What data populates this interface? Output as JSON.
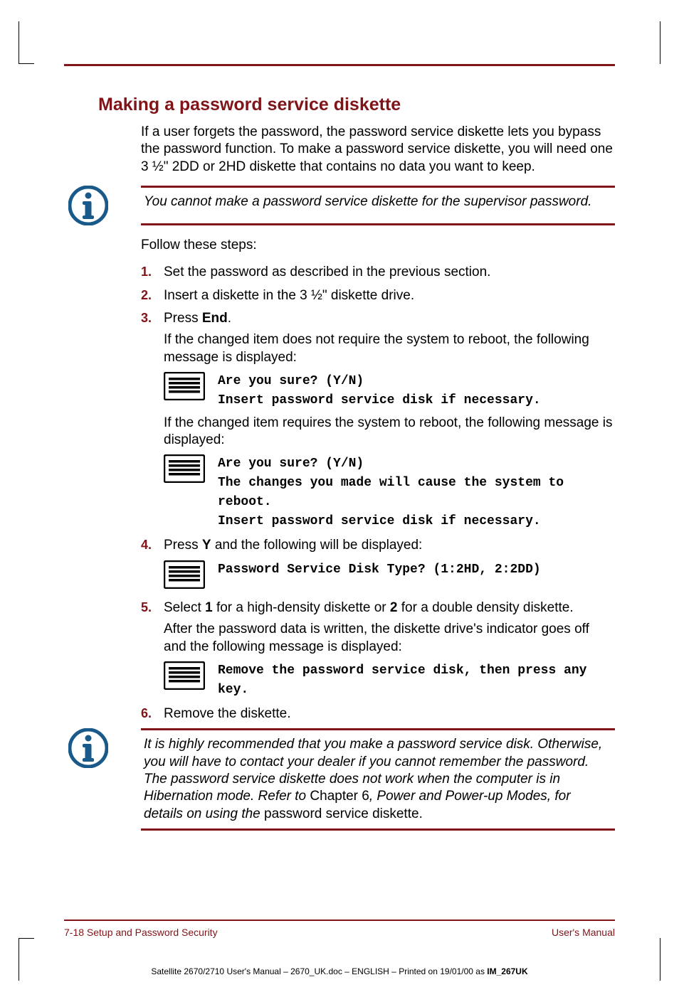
{
  "heading": "Making a password service diskette",
  "intro": "If a user forgets the password, the password service diskette lets you bypass the password function. To make a password service diskette, you will need one 3 ½\" 2DD or 2HD diskette that contains no data you want to keep.",
  "note1": "You cannot make a password service diskette for the supervisor password.",
  "follow": "Follow these steps:",
  "steps": {
    "s1": "Set the password as described in the previous section.",
    "s2": "Insert a diskette in the 3 ½\" diskette drive.",
    "s3a": "Press ",
    "s3b": "End",
    "s3c": ".",
    "s3_msg1_intro": "If the changed item does not require the system to reboot, the following message is displayed:",
    "s3_msg1_l1": "Are you sure? (Y/N)",
    "s3_msg1_l2": "Insert password service disk if necessary.",
    "s3_msg2_intro": "If the changed item requires the system to reboot, the following message is displayed:",
    "s3_msg2_l1": "Are you sure? (Y/N)",
    "s3_msg2_l2": "The changes you made will cause the system to reboot.",
    "s3_msg2_l3": "Insert password service disk if necessary.",
    "s4a": "Press ",
    "s4b": "Y",
    "s4c": " and the following will be displayed:",
    "s4_msg": "Password Service Disk Type? (1:2HD, 2:2DD)",
    "s5a": "Select ",
    "s5b": "1",
    "s5c": " for a high-density diskette or ",
    "s5d": "2",
    "s5e": " for a double density diskette.",
    "s5_after": "After the password data is written, the diskette drive's indicator goes off and the following message is displayed:",
    "s5_msg": "Remove the password service disk, then press any key.",
    "s6": "Remove the diskette."
  },
  "note2a": "It is highly recommended that you make a password service disk. Otherwise, you will have to contact your dealer if you cannot remember the password. The password service diskette does not work when the computer is in Hibernation mode. Refer to ",
  "note2b": "Chapter 6",
  "note2c": ", Power and Power-up Modes, for details on using the ",
  "note2d": "password service diskette",
  "note2e": ".",
  "footer_left": "7-18  Setup and Password Security",
  "footer_right": "User's Manual",
  "printline_a": "Satellite 2670/2710 User's Manual  – 2670_UK.doc – ENGLISH – Printed on 19/01/00 as ",
  "printline_b": "IM_267UK"
}
